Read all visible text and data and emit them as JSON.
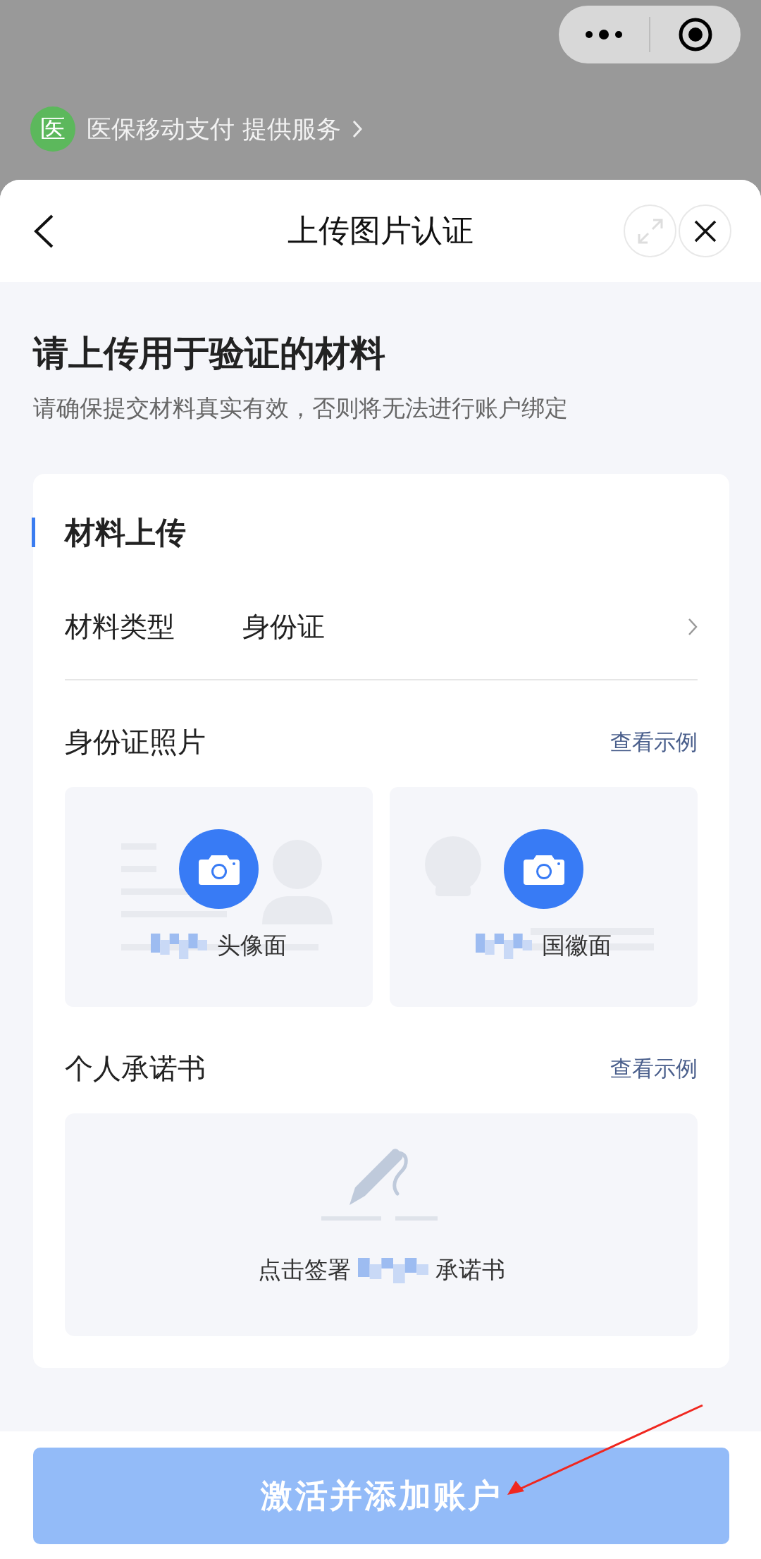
{
  "provider": {
    "badge": "医",
    "text": "医保移动支付 提供服务"
  },
  "header": {
    "title": "上传图片认证"
  },
  "intro": {
    "heading": "请上传用于验证的材料",
    "subtitle": "请确保提交材料真实有效，否则将无法进行账户绑定"
  },
  "card": {
    "title": "材料上传",
    "material_type": {
      "label": "材料类型",
      "value": "身份证"
    },
    "id_photos": {
      "title": "身份证照片",
      "link": "查看示例",
      "sides": [
        {
          "kind": "front",
          "label": "头像面"
        },
        {
          "kind": "back",
          "label": "国徽面"
        }
      ]
    },
    "pledge": {
      "title": "个人承诺书",
      "link": "查看示例",
      "prefix": "点击签署",
      "suffix": "承诺书"
    }
  },
  "submit": {
    "label": "激活并添加账户",
    "disabled": true
  }
}
